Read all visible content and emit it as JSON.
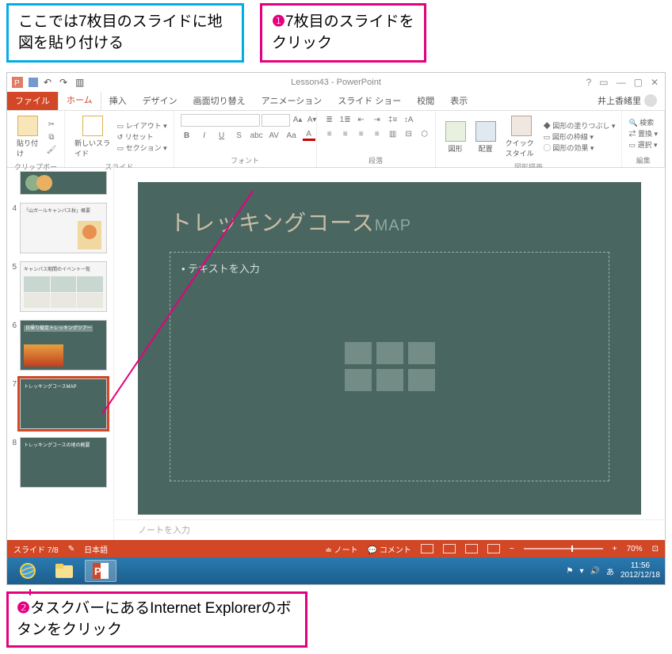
{
  "annotations": {
    "blue_box": "ここでは7枚目のスライドに地図を貼り付ける",
    "pink_box_top_num": "❶",
    "pink_box_top": "7枚目のスライドをクリック",
    "pink_box_bottom_num": "❷",
    "pink_box_bottom": "タスクバーにあるInternet Explorerのボタンをクリック"
  },
  "titlebar": {
    "doc_title": "Lesson43 - PowerPoint"
  },
  "ribbon": {
    "tabs": {
      "file": "ファイル",
      "home": "ホーム",
      "insert": "挿入",
      "design": "デザイン",
      "transitions": "画面切り替え",
      "animations": "アニメーション",
      "slideshow": "スライド ショー",
      "review": "校閲",
      "view": "表示"
    },
    "account_name": "井上香緒里",
    "groups": {
      "clipboard": {
        "label": "クリップボード",
        "paste": "貼り付け"
      },
      "slides": {
        "label": "スライド",
        "new_slide": "新しいスライド",
        "layout": "レイアウト",
        "reset": "リセット",
        "section": "セクション"
      },
      "font": {
        "label": "フォント"
      },
      "paragraph": {
        "label": "段落"
      },
      "drawing": {
        "label": "図形描画",
        "shapes": "図形",
        "arrange": "配置",
        "quick_styles": "クイックスタイル",
        "shape_fill": "図形の塗りつぶし",
        "shape_outline": "図形の枠線",
        "shape_effects": "図形の効果"
      },
      "editing": {
        "label": "編集",
        "find": "検索",
        "replace": "置換",
        "select": "選択"
      }
    }
  },
  "thumbnails": {
    "t4": "「山ガールキャンパス秋」概要",
    "t5": "キャンパス期間のイベント一覧",
    "t6": "日帰り縦走トレッキングツアー",
    "t7": "トレッキングコースMAP",
    "t8": "トレッキングコースの地の概要"
  },
  "slide": {
    "title_main": "トレッキングコース",
    "title_sub": "MAP",
    "placeholder_text": "• テキストを入力"
  },
  "notes_placeholder": "ノートを入力",
  "statusbar": {
    "slide_indicator": "スライド 7/8",
    "language": "日本語",
    "notes": "ノート",
    "comments": "コメント",
    "zoom": "70%"
  },
  "taskbar": {
    "time": "11:56",
    "date": "2012/12/18",
    "ime": "あ"
  }
}
